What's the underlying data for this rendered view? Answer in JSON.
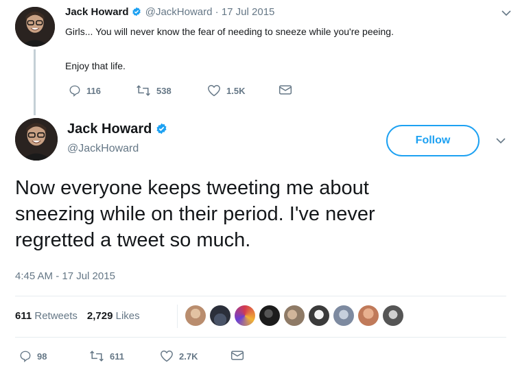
{
  "parent_tweet": {
    "name": "Jack Howard",
    "handle": "@JackHoward",
    "date": "· 17 Jul 2015",
    "text_line1": "Girls... You will never know the fear of needing to sneeze while you're peeing.",
    "text_line2": "Enjoy that life.",
    "replies": "116",
    "retweets": "538",
    "likes": "1.5K"
  },
  "main_tweet": {
    "name": "Jack Howard",
    "handle": "@JackHoward",
    "follow_label": "Follow",
    "text_lines": [
      "Now everyone keeps tweeting me about",
      "sneezing while on their period. I've never",
      "regretted a tweet so much."
    ],
    "timestamp": "4:45 AM - 17 Jul 2015",
    "retweet_count": "611",
    "retweet_label": "Retweets",
    "like_count": "2,729",
    "like_label": "Likes",
    "replies": "98",
    "retweets": "611",
    "likes": "2.7K"
  },
  "colors": {
    "accent": "#1da1f2",
    "secondary_text": "#657786",
    "primary_text": "#14171a",
    "divider": "#e6ecf0"
  },
  "icons": [
    "verified-badge-icon",
    "chevron-down-icon",
    "reply-icon",
    "retweet-icon",
    "like-icon",
    "direct-message-icon"
  ],
  "liker_avatar_colors": [
    "#b98d6e",
    "#2b2f3a",
    "#d43a4e",
    "#1c1c1c",
    "#8e7a66",
    "#3b3b3b",
    "#7d8aa0",
    "#c07a5a",
    "#555555"
  ]
}
